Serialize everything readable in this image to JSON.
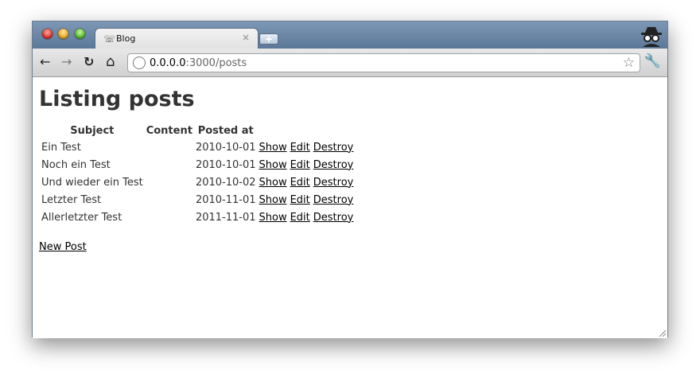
{
  "browser": {
    "tab_title": "Blog",
    "tab_close": "×",
    "new_tab": "+",
    "url_host": "0.0.0.0",
    "url_rest": ":3000/posts",
    "nav": {
      "back": "←",
      "forward": "→",
      "reload": "↻",
      "home": "⌂",
      "star": "☆",
      "wrench": "🔧"
    }
  },
  "page": {
    "title": "Listing posts",
    "columns": [
      "Subject",
      "Content",
      "Posted at"
    ],
    "rows": [
      {
        "subject": "Ein Test",
        "content": "",
        "posted_at": "2010-10-01"
      },
      {
        "subject": "Noch ein Test",
        "content": "",
        "posted_at": "2010-10-01"
      },
      {
        "subject": "Und wieder ein Test",
        "content": "",
        "posted_at": "2010-10-02"
      },
      {
        "subject": "Letzter Test",
        "content": "",
        "posted_at": "2010-11-01"
      },
      {
        "subject": "Allerletzter Test",
        "content": "",
        "posted_at": "2011-11-01"
      }
    ],
    "actions": {
      "show": "Show",
      "edit": "Edit",
      "destroy": "Destroy"
    },
    "new_post": "New Post"
  }
}
